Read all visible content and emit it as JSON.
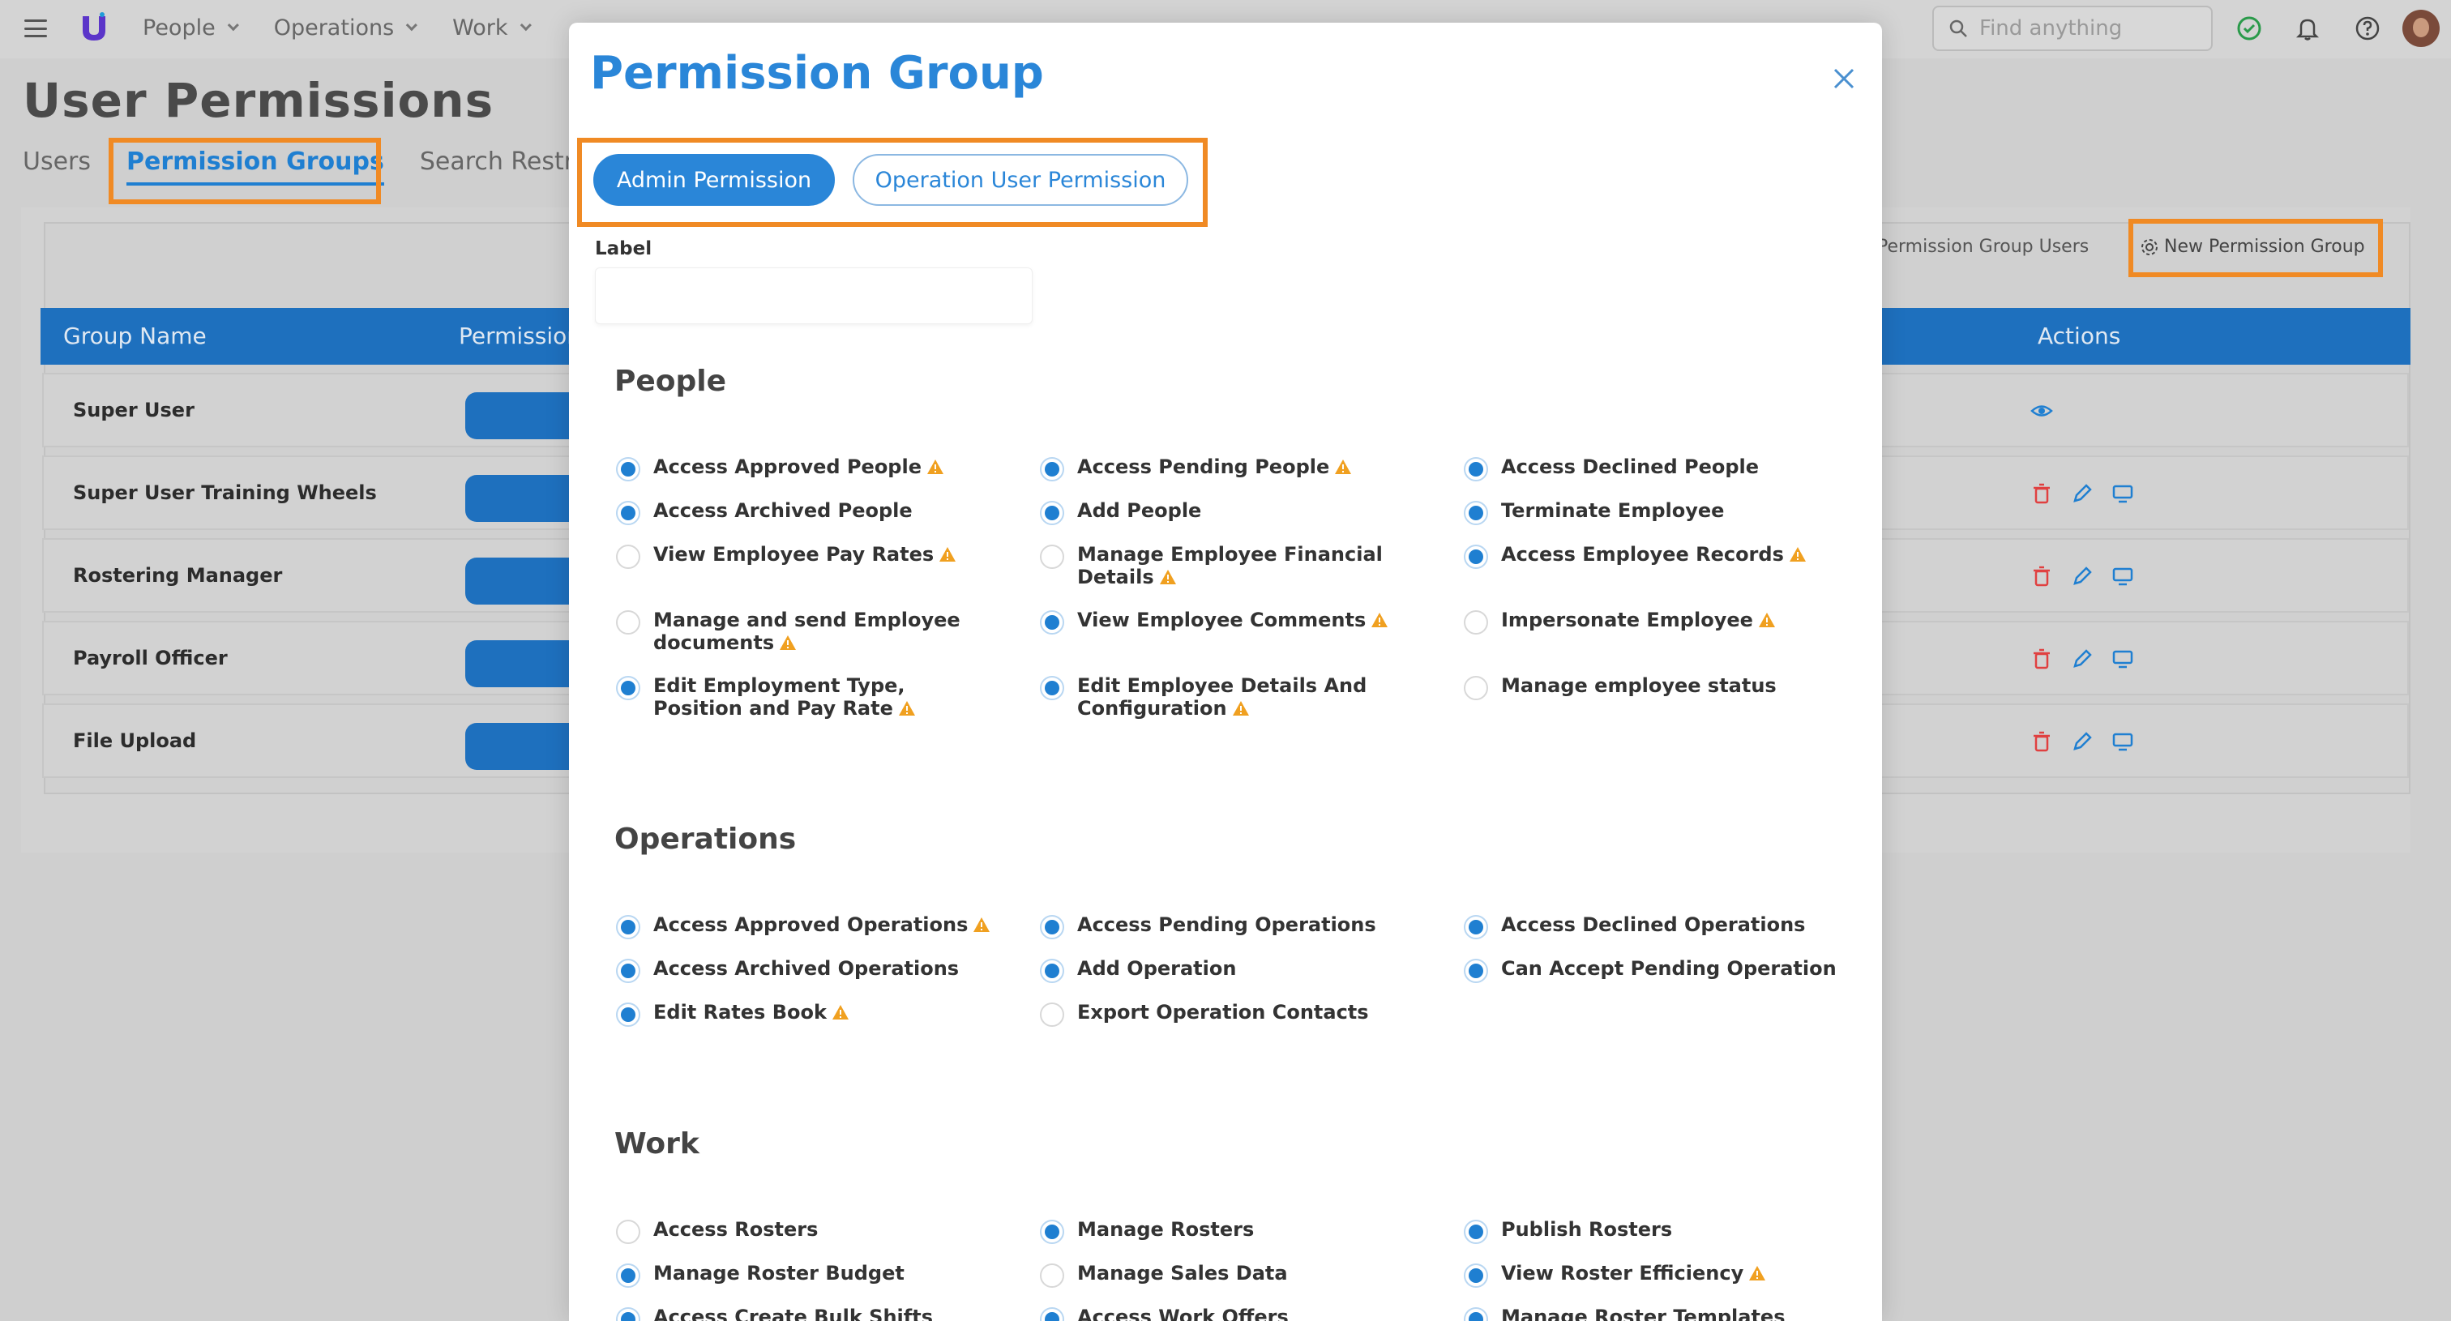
{
  "nav": {
    "items": [
      "People",
      "Operations",
      "Work"
    ],
    "search_placeholder": "Find anything"
  },
  "page": {
    "title": "User Permissions",
    "tabs": [
      "Users",
      "Permission Groups",
      "Search Restric"
    ],
    "toolbar_link": "Permission Group Users",
    "new_group_label": "New Permission Group",
    "table": {
      "headers": [
        "Group Name",
        "Permission",
        "Actions"
      ],
      "rows": [
        "Super User",
        "Super User Training Wheels",
        "Rostering Manager",
        "Payroll Officer",
        "File Upload"
      ]
    }
  },
  "modal": {
    "title": "Permission Group",
    "tabs": [
      "Admin Permission",
      "Operation User Permission"
    ],
    "label_caption": "Label",
    "label_value": "",
    "sections": {
      "people": {
        "title": "People",
        "items": [
          {
            "label": "Access Approved People",
            "checked": true,
            "warn": true
          },
          {
            "label": "Access Pending People",
            "checked": true,
            "warn": true
          },
          {
            "label": "Access Declined People",
            "checked": true,
            "warn": false
          },
          {
            "label": "Access Archived People",
            "checked": true,
            "warn": false
          },
          {
            "label": "Add People",
            "checked": true,
            "warn": false
          },
          {
            "label": "Terminate Employee",
            "checked": true,
            "warn": false
          },
          {
            "label": "View Employee Pay Rates",
            "checked": false,
            "warn": true
          },
          {
            "label": "Manage Employee Financial Details",
            "checked": false,
            "warn": true
          },
          {
            "label": "Access Employee Records",
            "checked": true,
            "warn": true
          },
          {
            "label": "Manage and send Employee documents",
            "checked": false,
            "warn": true
          },
          {
            "label": "View Employee Comments",
            "checked": true,
            "warn": true
          },
          {
            "label": "Impersonate Employee",
            "checked": false,
            "warn": true
          },
          {
            "label": "Edit Employment Type, Position and Pay Rate",
            "checked": true,
            "warn": true
          },
          {
            "label": "Edit Employee Details And Configuration",
            "checked": true,
            "warn": true
          },
          {
            "label": "Manage employee status",
            "checked": false,
            "warn": false
          }
        ]
      },
      "operations": {
        "title": "Operations",
        "items": [
          {
            "label": "Access Approved Operations",
            "checked": true,
            "warn": true
          },
          {
            "label": "Access Pending Operations",
            "checked": true,
            "warn": false
          },
          {
            "label": "Access Declined Operations",
            "checked": true,
            "warn": false
          },
          {
            "label": "Access Archived Operations",
            "checked": true,
            "warn": false
          },
          {
            "label": "Add Operation",
            "checked": true,
            "warn": false
          },
          {
            "label": "Can Accept Pending Operation",
            "checked": true,
            "warn": false
          },
          {
            "label": "Edit Rates Book",
            "checked": true,
            "warn": true
          },
          {
            "label": "Export Operation Contacts",
            "checked": false,
            "warn": false
          }
        ]
      },
      "work": {
        "title": "Work",
        "items": [
          {
            "label": "Access Rosters",
            "checked": false,
            "warn": false
          },
          {
            "label": "Manage Rosters",
            "checked": true,
            "warn": false
          },
          {
            "label": "Publish Rosters",
            "checked": true,
            "warn": false
          },
          {
            "label": "Manage Roster Budget",
            "checked": true,
            "warn": false
          },
          {
            "label": "Manage Sales Data",
            "checked": false,
            "warn": false
          },
          {
            "label": "View Roster Efficiency",
            "checked": true,
            "warn": true
          },
          {
            "label": "Access Create Bulk Shifts",
            "checked": true,
            "warn": false
          },
          {
            "label": "Access Work Offers",
            "checked": true,
            "warn": false
          },
          {
            "label": "Manage Roster Templates",
            "checked": true,
            "warn": false
          }
        ]
      }
    }
  },
  "colors": {
    "accent": "#2a86d8",
    "header_blue": "#1e70be",
    "highlight": "#f08a24",
    "warn": "#f0a020",
    "delete": "#e04040"
  }
}
